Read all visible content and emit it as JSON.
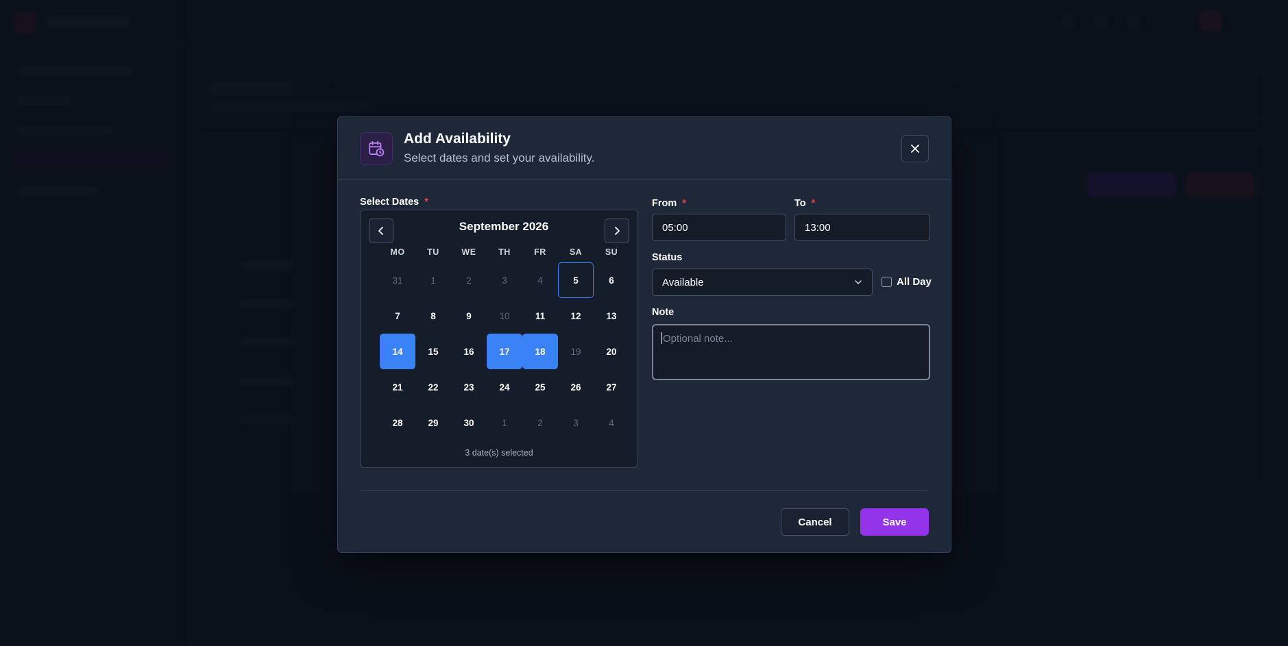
{
  "modal": {
    "title": "Add Availability",
    "subtitle": "Select dates and set your availability.",
    "icon": "calendar-clock-icon"
  },
  "dates": {
    "label": "Select Dates",
    "required_mark": "*",
    "month_label": "September 2026",
    "weekdays": [
      "MO",
      "TU",
      "WE",
      "TH",
      "FR",
      "SA",
      "SU"
    ],
    "weeks": [
      [
        {
          "d": "31",
          "s": "muted"
        },
        {
          "d": "1",
          "s": "muted"
        },
        {
          "d": "2",
          "s": "muted"
        },
        {
          "d": "3",
          "s": "muted"
        },
        {
          "d": "4",
          "s": "muted"
        },
        {
          "d": "5",
          "s": "today"
        },
        {
          "d": "6",
          "s": ""
        }
      ],
      [
        {
          "d": "7",
          "s": ""
        },
        {
          "d": "8",
          "s": ""
        },
        {
          "d": "9",
          "s": ""
        },
        {
          "d": "10",
          "s": "disabled"
        },
        {
          "d": "11",
          "s": ""
        },
        {
          "d": "12",
          "s": ""
        },
        {
          "d": "13",
          "s": ""
        }
      ],
      [
        {
          "d": "14",
          "s": "selected"
        },
        {
          "d": "15",
          "s": ""
        },
        {
          "d": "16",
          "s": ""
        },
        {
          "d": "17",
          "s": "selected"
        },
        {
          "d": "18",
          "s": "selected"
        },
        {
          "d": "19",
          "s": "disabled"
        },
        {
          "d": "20",
          "s": ""
        }
      ],
      [
        {
          "d": "21",
          "s": ""
        },
        {
          "d": "22",
          "s": ""
        },
        {
          "d": "23",
          "s": ""
        },
        {
          "d": "24",
          "s": ""
        },
        {
          "d": "25",
          "s": ""
        },
        {
          "d": "26",
          "s": ""
        },
        {
          "d": "27",
          "s": ""
        }
      ],
      [
        {
          "d": "28",
          "s": ""
        },
        {
          "d": "29",
          "s": ""
        },
        {
          "d": "30",
          "s": ""
        },
        {
          "d": "1",
          "s": "muted"
        },
        {
          "d": "2",
          "s": "muted"
        },
        {
          "d": "3",
          "s": "muted"
        },
        {
          "d": "4",
          "s": "muted"
        }
      ]
    ],
    "selected_summary": "3 date(s) selected"
  },
  "time": {
    "from_label": "From",
    "from_value": "05:00",
    "to_label": "To",
    "to_value": "13:00",
    "required_mark": "*"
  },
  "status": {
    "label": "Status",
    "value": "Available",
    "all_day_label": "All Day",
    "all_day_checked": false
  },
  "note": {
    "label": "Note",
    "placeholder": "Optional note..."
  },
  "footer": {
    "cancel_label": "Cancel",
    "save_label": "Save"
  },
  "colors": {
    "accent": "#9333ea",
    "selected_day": "#3b82f6",
    "required": "#ef4444"
  }
}
